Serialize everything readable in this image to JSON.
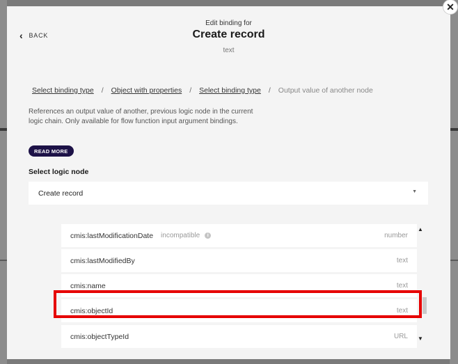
{
  "header": {
    "subtitle": "Edit binding for",
    "title": "Create record",
    "type": "text",
    "back_label": "BACK"
  },
  "breadcrumb": {
    "items": [
      {
        "label": "Select binding type"
      },
      {
        "label": "Object with properties"
      },
      {
        "label": "Select binding type"
      },
      {
        "label": "Output value of another node"
      }
    ],
    "separator": "/"
  },
  "description": "References an output value of another, previous logic node in the current logic chain. Only available for flow function input argument bindings.",
  "read_more_label": "READ MORE",
  "select": {
    "label": "Select logic node",
    "value": "Create record"
  },
  "rows": [
    {
      "name": "cmis:lastModificationDate",
      "status": "incompatible",
      "type": "number"
    },
    {
      "name": "cmis:lastModifiedBy",
      "type": "text"
    },
    {
      "name": "cmis:name",
      "type": "text"
    },
    {
      "name": "cmis:objectId",
      "type": "text"
    },
    {
      "name": "cmis:objectTypeId",
      "type": "URL"
    }
  ],
  "icons": {
    "close": "close-icon",
    "back": "chevron-left-icon",
    "dropdown": "caret-down-icon",
    "info": "info-icon",
    "scroll_up": "scroll-up-arrow-icon",
    "scroll_down": "scroll-down-arrow-icon"
  },
  "colors": {
    "accent_button": "#1d1247",
    "highlight": "#e60000"
  }
}
